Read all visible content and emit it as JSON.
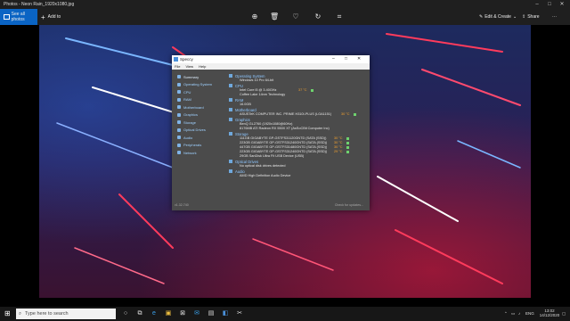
{
  "window": {
    "title": "Photos - Neon Rain_1920x1080.jpg",
    "controls": [
      "–",
      "□",
      "✕"
    ]
  },
  "toolbar": {
    "see_all_photos": "See all photos",
    "add_to": "Add to",
    "edit_create": "Edit & Create",
    "share": "Share",
    "more": "···",
    "icons": [
      "zoom-in-icon",
      "delete-icon",
      "heart-icon",
      "rotate-icon",
      "crop-icon"
    ]
  },
  "speccy": {
    "title": "Speccy",
    "controls": [
      "–",
      "□",
      "✕"
    ],
    "menu": [
      "File",
      "View",
      "Help"
    ],
    "nav": [
      "Summary",
      "Operating System",
      "CPU",
      "RAM",
      "Motherboard",
      "Graphics",
      "Storage",
      "Optical Drives",
      "Audio",
      "Peripherals",
      "Network"
    ],
    "sections": [
      {
        "title": "Operating System",
        "lines": [
          "Windows 10 Pro 64-bit"
        ]
      },
      {
        "title": "CPU",
        "lines": [
          "Intel Core i5 @ 3.40GHz",
          "Coffee Lake 14nm Technology"
        ],
        "temp": "37 °C"
      },
      {
        "title": "RAM",
        "lines": [
          "16.0GB"
        ]
      },
      {
        "title": "Motherboard",
        "lines": [
          "ASUSTeK COMPUTER INC. PRIME H310I-PLUS (LGA1151)"
        ],
        "temp": "30 °C"
      },
      {
        "title": "Graphics",
        "lines": [
          "BenQ GL2760 (1920x1080@60Hz)",
          "8176MB ATI Radeon RX 550X XT (AsSoCBit Computer Inc)"
        ]
      },
      {
        "title": "Storage",
        "lines": [
          "111GB GIGABYTE GP-GSTFS31120GNTD (SATA (SSD))",
          "223GB GIGABYTE GP-GSTFS31240GNTD (SATA (SSD))",
          "447GB GIGABYTE GP-GSTFS31480GNTD (SATA (SSD))",
          "223GB GIGABYTE GP-GSTFS31240GNTD (SATA (SSD))",
          "29GB SanDisk Ultra Fit USB Device (USB)"
        ],
        "temps": [
          "30 °C",
          "30 °C",
          "30 °C",
          "29 °C"
        ]
      },
      {
        "title": "Optical Drives",
        "lines": [
          "No optical disk drives detected"
        ]
      },
      {
        "title": "Audio",
        "lines": [
          "AMD High Definition Audio Device"
        ]
      }
    ],
    "status_left": "v1.32.740",
    "status_right": "Check for updates..."
  },
  "taskbar": {
    "search_placeholder": "Type here to search",
    "time": "13:02",
    "date": "14/12/2020",
    "lang": "ENG"
  }
}
